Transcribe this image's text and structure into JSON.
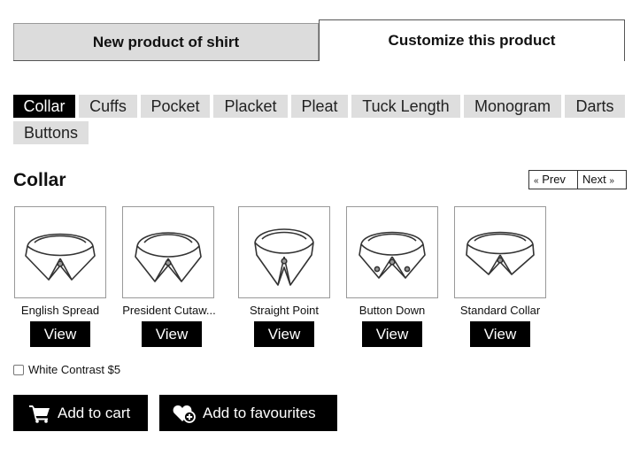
{
  "main_tabs": [
    {
      "label": "New product of shirt"
    },
    {
      "label": "Customize this product"
    }
  ],
  "sub_tabs": [
    {
      "label": "Collar",
      "selected": true
    },
    {
      "label": "Cuffs"
    },
    {
      "label": "Pocket"
    },
    {
      "label": "Placket"
    },
    {
      "label": "Pleat"
    },
    {
      "label": "Tuck Length"
    },
    {
      "label": "Monogram"
    },
    {
      "label": "Darts"
    },
    {
      "label": "Buttons"
    }
  ],
  "section": {
    "title": "Collar",
    "prev_label": "Prev",
    "next_label": "Next",
    "prev_icon": "«",
    "next_icon": "»"
  },
  "collars": [
    {
      "label": "English Spread",
      "view_label": "View",
      "icon": "english-spread-collar-icon"
    },
    {
      "label": "President Cutaw...",
      "view_label": "View",
      "icon": "president-cutaway-collar-icon"
    },
    {
      "label": "Straight Point",
      "view_label": "View",
      "icon": "straight-point-collar-icon"
    },
    {
      "label": "Button Down",
      "view_label": "View",
      "icon": "button-down-collar-icon"
    },
    {
      "label": "Standard Collar",
      "view_label": "View",
      "icon": "standard-collar-icon"
    }
  ],
  "option": {
    "label": "White Contrast $5",
    "checked": false
  },
  "actions": {
    "add_to_cart": "Add to cart",
    "add_to_favourites": "Add to favourites"
  },
  "colors": {
    "accent": "#000000",
    "tab_bg": "#dedede"
  }
}
